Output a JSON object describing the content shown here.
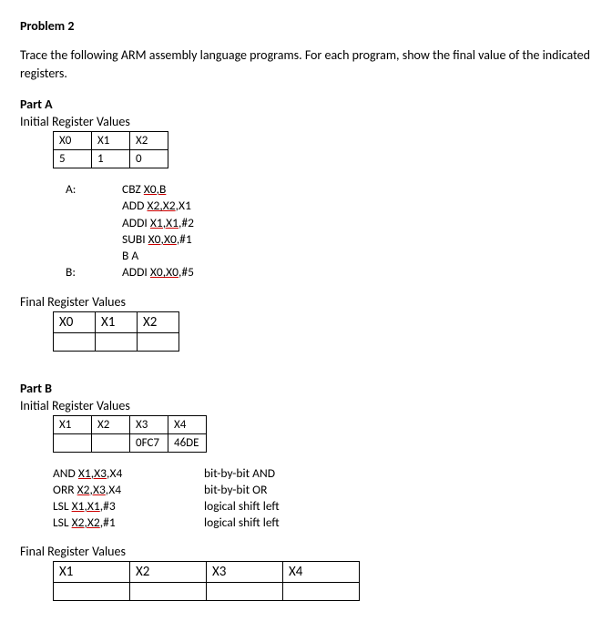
{
  "problem_title": "Problem 2",
  "instructions": "Trace the following ARM assembly language programs. For each program, show the final value of the indicated registers.",
  "partA": {
    "label": "Part A",
    "initial_caption": "Initial Register Values",
    "initial_headers": [
      "X0",
      "X1",
      "X2"
    ],
    "initial_values": [
      "5",
      "1",
      "0"
    ],
    "code": [
      {
        "label": "A:",
        "instr": "CBZ X0,B",
        "u_start": 4,
        "u_end": 8
      },
      {
        "label": "",
        "instr": "ADD X2,X2,X1",
        "u_start": 4,
        "u_end": 9
      },
      {
        "label": "",
        "instr": "ADDI X1,X1,#2",
        "u_start": 5,
        "u_end": 10
      },
      {
        "label": "",
        "instr": "SUBI X0,X0,#1",
        "u_start": 5,
        "u_end": 10
      },
      {
        "label": "",
        "instr": "B A"
      },
      {
        "label": "B:",
        "instr": "ADDI X0,X0,#5",
        "u_start": 5,
        "u_end": 10
      }
    ],
    "final_caption": "Final Register Values",
    "final_headers": [
      "X0",
      "X1",
      "X2"
    ]
  },
  "partB": {
    "label": "Part B",
    "initial_caption": "Initial Register Values",
    "initial_headers": [
      "X1",
      "X2",
      "X3",
      "X4"
    ],
    "initial_values": [
      "",
      "",
      "0FC7",
      "46DE"
    ],
    "code": [
      {
        "instr": "AND X1,X3,X4",
        "comment": "bit-by-bit AND",
        "u_start": 4,
        "u_end": 9
      },
      {
        "instr": "ORR X2,X3,X4",
        "comment": "bit-by-bit OR",
        "u_start": 4,
        "u_end": 9
      },
      {
        "instr": "LSL X1,X1,#3",
        "comment": "logical shift left",
        "u_start": 4,
        "u_end": 9
      },
      {
        "instr": "LSL X2,X2,#1",
        "comment": "logical shift left",
        "u_start": 4,
        "u_end": 9
      }
    ],
    "final_caption": "Final Register Values",
    "final_headers": [
      "X1",
      "X2",
      "X3",
      "X4"
    ]
  }
}
